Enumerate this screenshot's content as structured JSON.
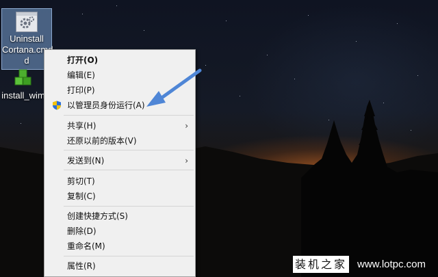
{
  "desktop": {
    "icons": [
      {
        "label_line1": "Uninstall",
        "label_line2": "Cortana.cmd",
        "label_line3": "d"
      },
      {
        "label": "install_wim"
      }
    ]
  },
  "context_menu": {
    "items": [
      {
        "label": "打开(O)",
        "bold": true
      },
      {
        "label": "编辑(E)"
      },
      {
        "label": "打印(P)"
      },
      {
        "label": "以管理员身份运行(A)",
        "icon": "uac-shield-icon"
      },
      {
        "label": "共享(H)",
        "submenu": true
      },
      {
        "label": "还原以前的版本(V)"
      },
      {
        "label": "发送到(N)",
        "submenu": true
      },
      {
        "label": "剪切(T)"
      },
      {
        "label": "复制(C)"
      },
      {
        "label": "创建快捷方式(S)"
      },
      {
        "label": "删除(D)"
      },
      {
        "label": "重命名(M)"
      },
      {
        "label": "属性(R)"
      }
    ],
    "submenu_glyph": "›"
  },
  "watermark": {
    "left": "装机之家",
    "right": "www.lotpc.com"
  },
  "colors": {
    "annotation_arrow": "#4f86d6",
    "menu_background": "#f0f0f0"
  }
}
